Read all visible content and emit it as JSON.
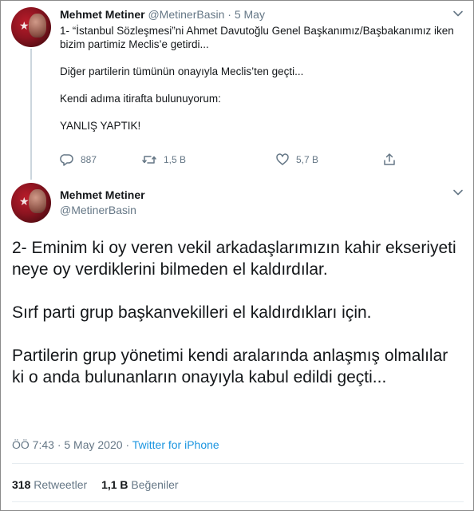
{
  "tweet1": {
    "name": "Mehmet Metiner",
    "handle": "@MetinerBasin",
    "separator": "·",
    "date": "5 May",
    "lines": [
      "1- “İstanbul Sözleşmesi”ni Ahmet Davutoğlu Genel Başkanımız/Başbakanımız iken bizim partimiz Meclis’e getirdi...",
      "Diğer partilerin tümünün onayıyla Meclis’ten geçti...",
      "Kendi adıma itirafta bulunuyorum:",
      "YANLIŞ YAPTIK!"
    ],
    "actions": {
      "replies": "887",
      "retweets": "1,5 B",
      "likes": "5,7 B"
    }
  },
  "tweet2": {
    "name": "Mehmet Metiner",
    "handle": "@MetinerBasin",
    "paragraphs": [
      "2- Eminim ki oy veren vekil arkadaşlarımızın kahir ekseriyeti neye oy verdiklerini bilmeden el kaldırdılar.",
      "Sırf parti grup başkanvekilleri el kaldırdıkları için.",
      "Partilerin grup yönetimi kendi aralarında anlaşmış olmalılar ki o anda bulunanların onayıyla kabul edildi geçti..."
    ],
    "time": "ÖÖ 7:43",
    "date": "5 May 2020",
    "dot": "·",
    "source": "Twitter for iPhone",
    "stats": {
      "retweets_count": "318",
      "retweets_label": "Retweetler",
      "likes_count": "1,1 B",
      "likes_label": "Beğeniler"
    }
  },
  "icons": {
    "avatar": "avatar",
    "more": "chevron-down-icon",
    "reply": "reply-icon",
    "retweet": "retweet-icon",
    "like": "heart-icon",
    "share": "share-icon"
  },
  "colors": {
    "text": "#14171a",
    "secondary": "#657786",
    "link": "#1b95e0",
    "thread_line": "#ccd6dd"
  }
}
